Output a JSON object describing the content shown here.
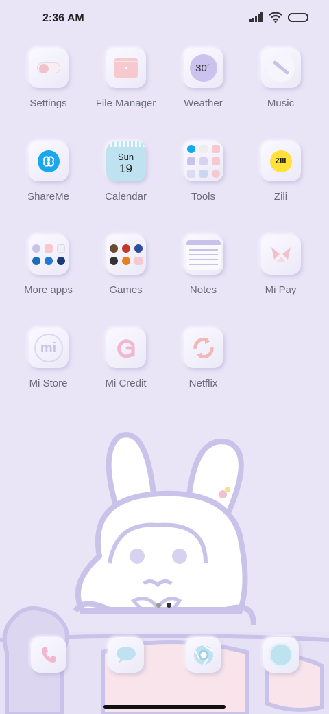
{
  "status_bar": {
    "time": "2:36 AM",
    "icons": [
      "signal-icon",
      "wifi-icon",
      "battery-icon"
    ]
  },
  "apps": [
    {
      "label": "Settings",
      "icon": "settings-toggle-icon"
    },
    {
      "label": "File Manager",
      "icon": "folder-icon"
    },
    {
      "label": "Weather",
      "icon": "weather-icon",
      "badge": "30°"
    },
    {
      "label": "Music",
      "icon": "music-icon"
    },
    {
      "label": "ShareMe",
      "icon": "shareme-icon"
    },
    {
      "label": "Calendar",
      "icon": "calendar-icon",
      "day": "Sun",
      "date": "19"
    },
    {
      "label": "Tools",
      "icon": "tools-folder-icon"
    },
    {
      "label": "Zili",
      "icon": "zili-icon",
      "badge": "Zili"
    },
    {
      "label": "More apps",
      "icon": "more-apps-folder-icon"
    },
    {
      "label": "Games",
      "icon": "games-folder-icon"
    },
    {
      "label": "Notes",
      "icon": "notes-icon"
    },
    {
      "label": "Mi Pay",
      "icon": "mi-pay-icon"
    },
    {
      "label": "Mi Store",
      "icon": "mi-store-icon",
      "badge": "mi"
    },
    {
      "label": "Mi Credit",
      "icon": "mi-credit-icon"
    },
    {
      "label": "Netflix",
      "icon": "netflix-icon"
    }
  ],
  "page_indicator": {
    "pages": 2,
    "current": 2
  },
  "dock": [
    {
      "icon": "phone-icon"
    },
    {
      "icon": "messages-icon"
    },
    {
      "icon": "browser-icon"
    },
    {
      "icon": "camera-icon"
    }
  ],
  "colors": {
    "background": "#e9e5f7",
    "accent_lavender": "#c9c3ea",
    "accent_pink": "#f2c2cc",
    "shareme_blue": "#1aa7f0",
    "zili_yellow": "#ffe13a"
  }
}
